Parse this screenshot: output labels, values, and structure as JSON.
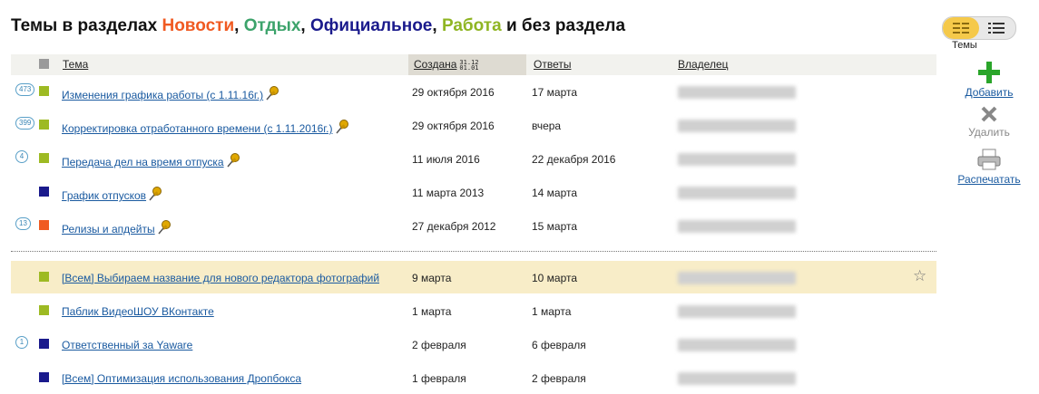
{
  "heading": {
    "prefix": "Темы в разделах ",
    "sections": [
      {
        "label": "Новости",
        "color": "#f05a22"
      },
      {
        "label": "Отдых",
        "color": "#3ca36b"
      },
      {
        "label": "Официальное",
        "color": "#1a1a8c"
      },
      {
        "label": "Работа",
        "color": "#8fb523"
      }
    ],
    "sep": ", ",
    "suffix": " и без раздела"
  },
  "columns": {
    "topic": "Тема",
    "created": "Создана",
    "replies": "Ответы",
    "owner": "Владелец"
  },
  "rows": [
    {
      "count": "473",
      "color": "#9dba23",
      "topic": "Изменения графика работы (с 1.11.16г.)",
      "pinned": true,
      "created": "29 октября 2016",
      "replies": "17 марта"
    },
    {
      "count": "399",
      "color": "#9dba23",
      "topic": "Корректировка отработанного времени (с 1.11.2016г.)",
      "pinned": true,
      "created": "29 октября 2016",
      "replies": "вчера"
    },
    {
      "count": "4",
      "color": "#9dba23",
      "topic": "Передача дел на время отпуска",
      "pinned": true,
      "created": "11 июля 2016",
      "replies": "22 декабря 2016"
    },
    {
      "count": "",
      "color": "#1a1a8c",
      "topic": "График отпусков",
      "pinned": true,
      "created": "11 марта 2013",
      "replies": "14 марта"
    },
    {
      "count": "13",
      "color": "#f05a22",
      "topic": "Релизы и апдейты",
      "pinned": true,
      "created": "27 декабря 2012",
      "replies": "15 марта"
    },
    {
      "count": "",
      "color": "#9dba23",
      "topic": "[Всем] Выбираем название для нового редактора фотографий",
      "pinned": false,
      "created": "9 марта",
      "replies": "10 марта",
      "highlight": true
    },
    {
      "count": "",
      "color": "#9dba23",
      "topic": "Паблик ВидеоШОУ ВКонтакте",
      "pinned": false,
      "created": "1 марта",
      "replies": "1 марта"
    },
    {
      "count": "1",
      "color": "#1a1a8c",
      "topic": "Ответственный за Yaware",
      "pinned": false,
      "created": "2 февраля",
      "replies": "6 февраля"
    },
    {
      "count": "",
      "color": "#1a1a8c",
      "topic": "[Всем] Оптимизация использования Дропбокса",
      "pinned": false,
      "created": "1 февраля",
      "replies": "2 февраля"
    }
  ],
  "sidebar": {
    "view_label": "Темы",
    "add": "Добавить",
    "delete": "Удалить",
    "print": "Распечатать",
    "add_color": "#2aa52a"
  },
  "icons": {
    "pin": "pushpin-icon",
    "star": "star-icon",
    "add": "plus-icon",
    "delete": "x-icon",
    "print": "printer-icon"
  }
}
